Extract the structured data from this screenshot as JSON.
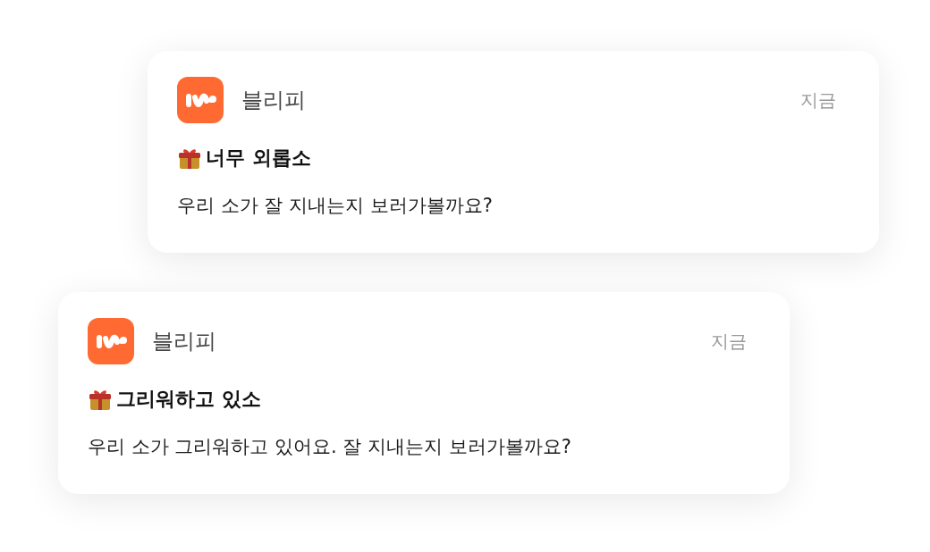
{
  "notifications": [
    {
      "app_name": "블리피",
      "time": "지금",
      "title": "너무 외롭소",
      "message": "우리 소가 잘 지내는지 보러가볼까요?"
    },
    {
      "app_name": "블리피",
      "time": "지금",
      "title": "그리워하고 있소",
      "message": "우리 소가 그리워하고 있어요. 잘 지내는지 보러가볼까요?"
    }
  ]
}
